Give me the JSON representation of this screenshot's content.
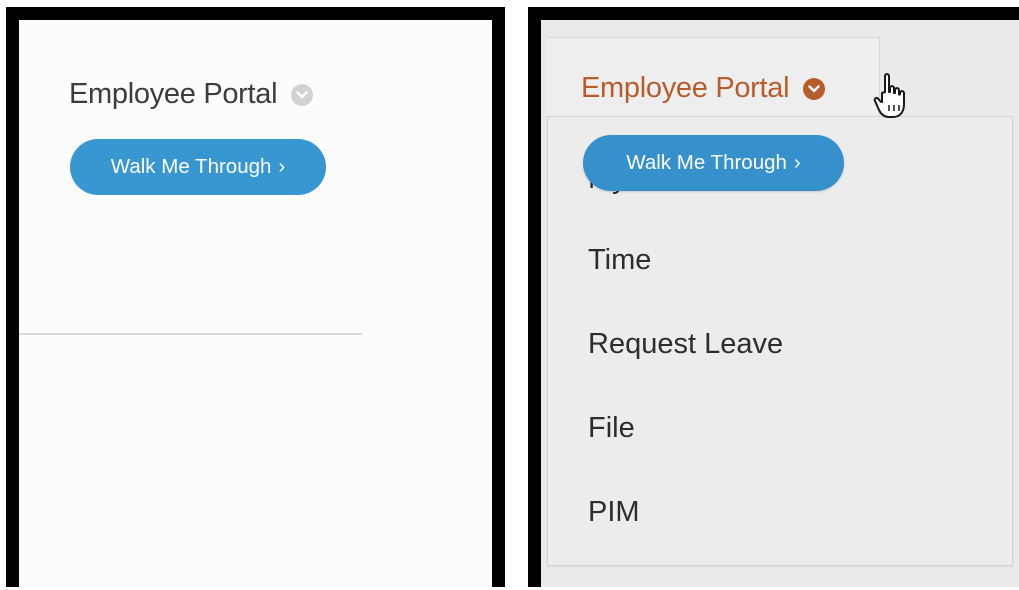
{
  "left": {
    "title": "Employee Portal",
    "button_label": "Walk Me Through",
    "button_arrow": "›"
  },
  "right": {
    "title": "Employee Portal",
    "button_label": "Walk Me Through",
    "button_arrow": "›",
    "menu": [
      {
        "label": "My Info"
      },
      {
        "label": "Time"
      },
      {
        "label": "Request Leave"
      },
      {
        "label": "File"
      },
      {
        "label": "PIM"
      }
    ]
  },
  "colors": {
    "button_blue": "#3896d1",
    "title_gray": "#3c3c3c",
    "title_active_orange": "#b75d2c",
    "chevron_inactive": "#d2d2d2",
    "chevron_active": "#b75d2c"
  },
  "icons": {
    "chevron": "chevron-down-icon",
    "cursor": "hand-pointer-icon"
  }
}
